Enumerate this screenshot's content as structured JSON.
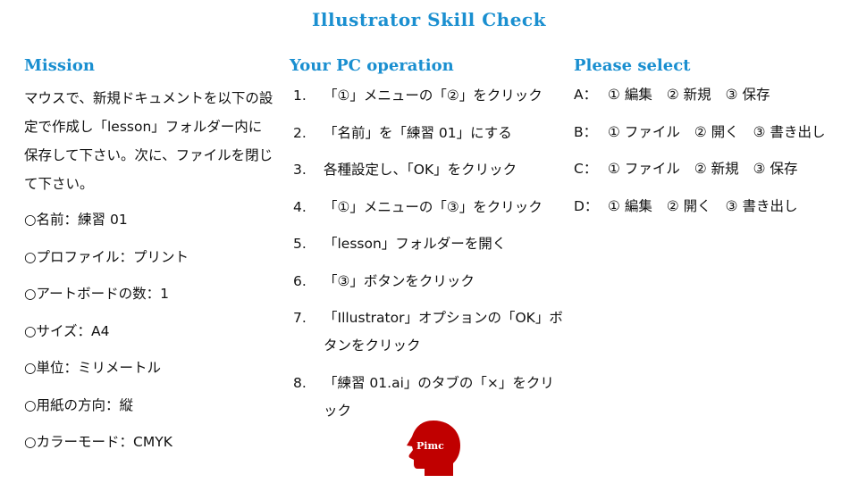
{
  "title": "Illustrator Skill Check",
  "mission": {
    "heading": "Mission",
    "paragraph": "マウスで、新規ドキュメントを以下の設定で作成し「lesson」フォルダー内に保存して下さい。次に、ファイルを閉じて下さい。",
    "settings": [
      "○名前：練習 01",
      "○プロファイル：プリント",
      "○アートボードの数：1",
      "○サイズ：A4",
      "○単位：ミリメートル",
      "○用紙の方向：縦",
      "○カラーモード：CMYK"
    ]
  },
  "operation": {
    "heading": "Your PC operation",
    "steps": [
      {
        "num": "1.",
        "text": "「①」メニューの「②」をクリック"
      },
      {
        "num": "2.",
        "text": "「名前」を「練習 01」にする"
      },
      {
        "num": "3.",
        "text": "各種設定し、「OK」をクリック"
      },
      {
        "num": "4.",
        "text": "「①」メニューの「③」をクリック"
      },
      {
        "num": "5.",
        "text": "「lesson」フォルダーを開く"
      },
      {
        "num": "6.",
        "text": "「③」ボタンをクリック"
      },
      {
        "num": "7.",
        "text": "「Illustrator」オプションの「OK」ボタンをクリック"
      },
      {
        "num": "8.",
        "text": "「練習 01.ai」のタブの「×」をクリック"
      }
    ]
  },
  "select": {
    "heading": "Please select",
    "options": [
      {
        "letter": "A：",
        "choices": [
          "① 編集",
          "② 新規",
          "③ 保存"
        ]
      },
      {
        "letter": "B：",
        "choices": [
          "① ファイル",
          "② 開く",
          "③ 書き出し"
        ]
      },
      {
        "letter": "C：",
        "choices": [
          "① ファイル",
          "② 新規",
          "③ 保存"
        ]
      },
      {
        "letter": "D：",
        "choices": [
          "① 編集",
          "② 開く",
          "③ 書き出し"
        ]
      }
    ]
  },
  "logo": {
    "text": "Pimc",
    "color": "#c00000"
  },
  "colors": {
    "heading": "#1a8fd0",
    "text": "#111111"
  }
}
